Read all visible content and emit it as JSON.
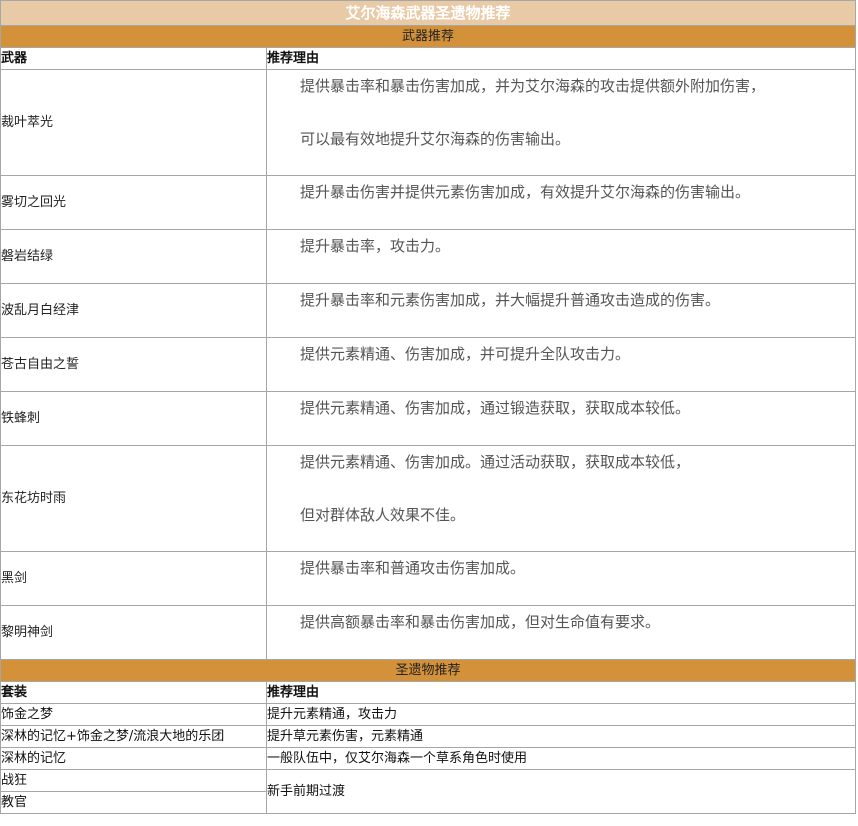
{
  "title": "艾尔海森武器圣遗物推荐",
  "weapons": {
    "section_label": "武器推荐",
    "col_name": "武器",
    "col_reason": "推荐理由",
    "rows": [
      {
        "name": "裁叶萃光",
        "reason": [
          "提供暴击率和暴击伤害加成，并为艾尔海森的攻击提供额外附加伤害，",
          "可以最有效地提升艾尔海森的伤害输出。"
        ]
      },
      {
        "name": "雾切之回光",
        "reason": [
          "提升暴击伤害并提供元素伤害加成，有效提升艾尔海森的伤害输出。"
        ]
      },
      {
        "name": "磐岩结绿",
        "reason": [
          "提升暴击率，攻击力。"
        ]
      },
      {
        "name": "波乱月白经津",
        "reason": [
          "提升暴击率和元素伤害加成，并大幅提升普通攻击造成的伤害。"
        ]
      },
      {
        "name": "苍古自由之誓",
        "reason": [
          "提供元素精通、伤害加成，并可提升全队攻击力。"
        ]
      },
      {
        "name": "铁蜂刺",
        "reason": [
          "提供元素精通、伤害加成，通过锻造获取，获取成本较低。"
        ]
      },
      {
        "name": "东花坊时雨",
        "reason": [
          "提供元素精通、伤害加成。通过活动获取，获取成本较低，",
          "但对群体敌人效果不佳。"
        ]
      },
      {
        "name": "黑剑",
        "reason": [
          "提供暴击率和普通攻击伤害加成。"
        ]
      },
      {
        "name": "黎明神剑",
        "reason": [
          "提供高额暴击率和暴击伤害加成，但对生命值有要求。"
        ]
      }
    ]
  },
  "artifacts": {
    "section_label": "圣遗物推荐",
    "col_name": "套装",
    "col_reason": "推荐理由",
    "rows": [
      {
        "name": "饰金之梦",
        "reason": "提升元素精通，攻击力"
      },
      {
        "name": "深林的记忆+饰金之梦/流浪大地的乐团",
        "reason": "提升草元素伤害，元素精通"
      },
      {
        "name": "深林的记忆",
        "reason": "一般队伍中，仅艾尔海森一个草系角色时使用"
      },
      {
        "name": "战狂",
        "reason": "新手前期过渡"
      },
      {
        "name": "教官",
        "reason": "新手前期过渡"
      }
    ]
  }
}
